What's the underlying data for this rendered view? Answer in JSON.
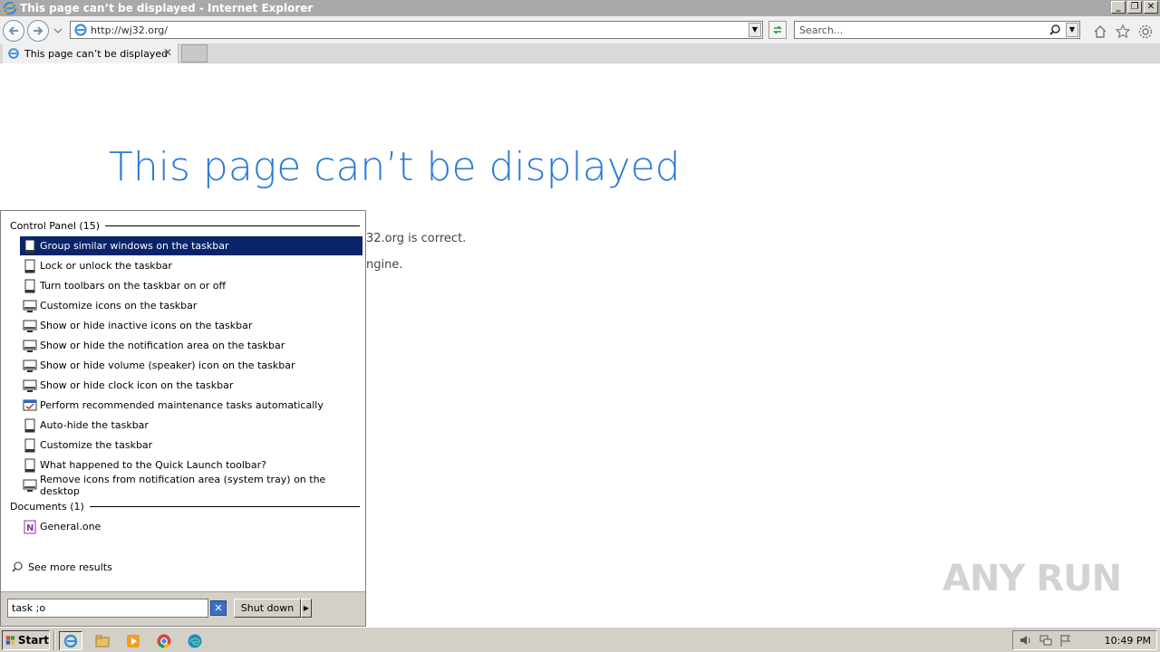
{
  "window": {
    "title": "This page can’t be displayed - Internet Explorer",
    "minimize": "_",
    "restore": "❐",
    "close": "✕"
  },
  "nav": {
    "url": "http://wj32.org/",
    "search_placeholder": "Search..."
  },
  "tabs": [
    {
      "label": "This page can’t be displayed",
      "close": "✕"
    }
  ],
  "page": {
    "heading": "This page can’t be displayed",
    "line1": "32.org is correct.",
    "line2": "ngine."
  },
  "watermark": "ANY RUN",
  "start_menu": {
    "groups": [
      {
        "header": "Control Panel (15)",
        "items": [
          {
            "label": "Group similar windows on the taskbar",
            "icon": "taskbar-icon",
            "selected": true
          },
          {
            "label": "Lock or unlock the taskbar",
            "icon": "taskbar-icon",
            "selected": false
          },
          {
            "label": "Turn toolbars on the taskbar on or off",
            "icon": "taskbar-icon",
            "selected": false
          },
          {
            "label": "Customize icons on the taskbar",
            "icon": "notification-area-icon",
            "selected": false
          },
          {
            "label": "Show or hide inactive icons on the taskbar",
            "icon": "notification-area-icon",
            "selected": false
          },
          {
            "label": "Show or hide the notification area on the taskbar",
            "icon": "notification-area-icon",
            "selected": false
          },
          {
            "label": "Show or hide volume (speaker) icon on the taskbar",
            "icon": "notification-area-icon",
            "selected": false
          },
          {
            "label": "Show or hide clock icon on the taskbar",
            "icon": "notification-area-icon",
            "selected": false
          },
          {
            "label": "Perform recommended maintenance tasks automatically",
            "icon": "action-center-icon",
            "selected": false
          },
          {
            "label": "Auto-hide the taskbar",
            "icon": "taskbar-icon",
            "selected": false
          },
          {
            "label": "Customize the taskbar",
            "icon": "taskbar-icon",
            "selected": false
          },
          {
            "label": "What happened to the Quick Launch toolbar?",
            "icon": "taskbar-icon",
            "selected": false
          },
          {
            "label": "Remove icons from notification area (system tray) on the desktop",
            "icon": "notification-area-icon",
            "selected": false
          }
        ]
      },
      {
        "header": "Documents (1)",
        "items": [
          {
            "label": "General.one",
            "icon": "onenote-icon",
            "selected": false
          }
        ]
      }
    ],
    "see_more": "See more results",
    "search_value": "task ;o",
    "clear": "✕",
    "shutdown_label": "Shut down",
    "shutdown_arrow": "▶"
  },
  "taskbar": {
    "start_label": "Start",
    "quick_launch": [
      "internet-explorer-icon",
      "file-explorer-icon",
      "media-player-icon",
      "chrome-icon",
      "edge-icon"
    ],
    "tray": [
      "volume-icon",
      "network-icon",
      "action-center-flag-icon"
    ],
    "clock": "10:49 PM"
  },
  "colors": {
    "heading": "#2a7ad4",
    "selection": "#0a246a",
    "classic_gray": "#d4d0c8"
  }
}
